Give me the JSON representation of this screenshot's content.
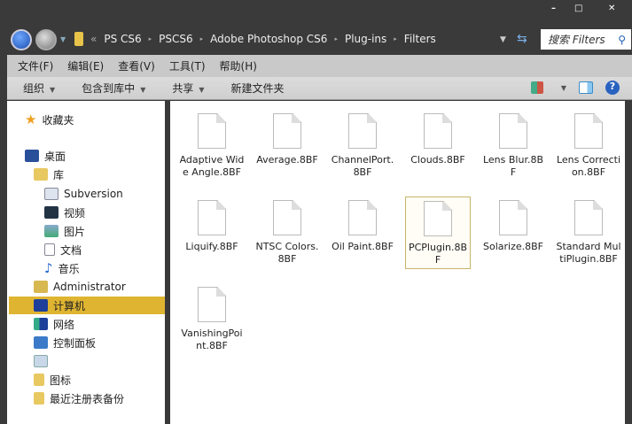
{
  "window": {
    "minimize": "–",
    "maximize": "□",
    "close": "✕"
  },
  "address": {
    "crumbs": [
      "PS CS6",
      "PSCS6",
      "Adobe Photoshop CS6",
      "Plug-ins",
      "Filters"
    ],
    "overflow": "«"
  },
  "search": {
    "placeholder": "搜索 Filters"
  },
  "menu": [
    "文件(F)",
    "编辑(E)",
    "查看(V)",
    "工具(T)",
    "帮助(H)"
  ],
  "toolbar": {
    "organize": "组织",
    "include": "包含到库中",
    "share": "共享",
    "new_folder": "新建文件夹"
  },
  "sidebar": {
    "favorites": "收藏夹",
    "desktop": "桌面",
    "library": "库",
    "subversion": "Subversion",
    "video": "视频",
    "pictures": "图片",
    "documents": "文档",
    "music": "音乐",
    "admin": "Administrator",
    "computer": "计算机",
    "network": "网络",
    "control_panel": "控制面板",
    "icons": "图标",
    "reg_backup": "最近注册表备份"
  },
  "files": [
    "Adaptive Wide Angle.8BF",
    "Average.8BF",
    "ChannelPort.8BF",
    "Clouds.8BF",
    "Lens Blur.8BF",
    "Lens Correction.8BF",
    "Liquify.8BF",
    "NTSC Colors.8BF",
    "Oil Paint.8BF",
    "PCPlugin.8BF",
    "Solarize.8BF",
    "Standard MultiPlugin.8BF",
    "VanishingPoint.8BF"
  ]
}
